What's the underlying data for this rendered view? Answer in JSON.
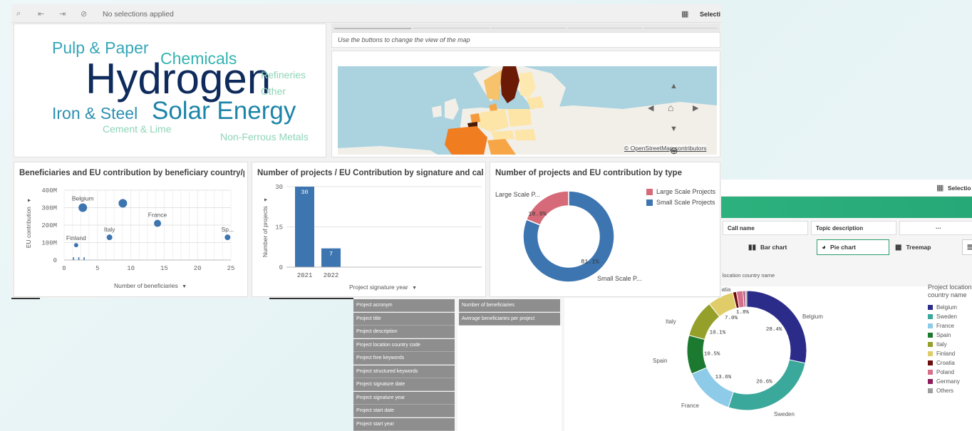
{
  "toolbar": {
    "no_selections": "No selections applied",
    "selections_label": "Selecti",
    "selections_label_back": "Selectio"
  },
  "word_cloud": {
    "words": [
      {
        "text": "Pulp & Paper",
        "color": "#37a6b8"
      },
      {
        "text": "Chemicals",
        "color": "#33b3b0"
      },
      {
        "text": "Hydrogen",
        "color": "#0e2b5c"
      },
      {
        "text": "Refineries",
        "color": "#8ed5b8"
      },
      {
        "text": "Other",
        "color": "#8ed5b8"
      },
      {
        "text": "Iron & Steel",
        "color": "#2d8fb0"
      },
      {
        "text": "Solar Energy",
        "color": "#1d85a8"
      },
      {
        "text": "Cement & Lime",
        "color": "#8ed5b8"
      },
      {
        "text": "Non-Ferrous Metals",
        "color": "#8ed5b8"
      }
    ]
  },
  "map": {
    "hint": "Use the buttons to change the view of the map",
    "attribution": "© OpenStreetMap contributors"
  },
  "charts": [
    {
      "title": "Beneficiaries and EU contribution by beneficiary country/pr...",
      "chart_data": {
        "type": "scatter",
        "xlabel": "Number of beneficiaries",
        "ylabel": "EU contribution",
        "x_ticks": [
          "0",
          "5",
          "10",
          "15",
          "20",
          "25"
        ],
        "y_ticks": [
          "0",
          "100M",
          "200M",
          "300M",
          "400M"
        ],
        "xlim": [
          0,
          25
        ],
        "ylim": [
          0,
          400
        ],
        "points": [
          {
            "label": "Belgium",
            "x": 2.8,
            "y": 300,
            "r": 6
          },
          {
            "label": "",
            "x": 8.8,
            "y": 325,
            "r": 6
          },
          {
            "label": "France",
            "x": 14,
            "y": 210,
            "r": 5
          },
          {
            "label": "Italy",
            "x": 6.8,
            "y": 130,
            "r": 4
          },
          {
            "label": "Finland",
            "x": 1.8,
            "y": 85,
            "r": 3
          },
          {
            "label": "Sp...",
            "x": 24.5,
            "y": 130,
            "r": 4
          },
          {
            "label": "",
            "x": 1.4,
            "y": 8,
            "r": 1
          },
          {
            "label": "",
            "x": 2.2,
            "y": 8,
            "r": 1
          },
          {
            "label": "",
            "x": 3.0,
            "y": 8,
            "r": 1
          }
        ]
      }
    },
    {
      "title": "Number of projects / EU Contribution by signature and call ...",
      "chart_data": {
        "type": "bar",
        "categories": [
          "2021",
          "2022"
        ],
        "values": [
          30,
          7
        ],
        "xlabel": "Project signature year",
        "ylabel": "Number of projects",
        "y_ticks": [
          "0",
          "15",
          "30"
        ],
        "ylim": [
          0,
          30
        ]
      }
    },
    {
      "title": "Number of projects and EU contribution by type",
      "chart_data": {
        "type": "pie",
        "slices": [
          {
            "label": "Large Scale P...",
            "value": 18.9,
            "text": "18.9%",
            "color": "#d66a78"
          },
          {
            "label": "Small Scale P...",
            "value": 81.1,
            "text": "81.1%",
            "color": "#3d75b0"
          }
        ],
        "legend": [
          "Large Scale Projects",
          "Small Scale Projects"
        ]
      }
    }
  ],
  "back": {
    "filters": [
      "Call name",
      "Topic description",
      "···"
    ],
    "views": [
      "Bar chart",
      "Pie chart",
      "Treemap"
    ],
    "dimension_list": [
      "Project acronym",
      "Project title",
      "Project description",
      "Project location country code",
      "Project free keywords",
      "Project structured keywords",
      "Project signature date",
      "Project signature year",
      "Project start date",
      "Project start year"
    ],
    "measure_list": [
      "Number of beneficiaries",
      "Average beneficiaries per project"
    ],
    "pie_title": "ject location country name",
    "legend_title_1": "Project location",
    "legend_title_2": "country name",
    "chart_data": {
      "type": "pie",
      "slices": [
        {
          "label": "Belgium",
          "value": 28.4,
          "text": "28.4%",
          "color": "#2b2b8a"
        },
        {
          "label": "Sweden",
          "value": 26.6,
          "text": "26.6%",
          "color": "#3aa89a"
        },
        {
          "label": "France",
          "value": 13.6,
          "text": "13.6%",
          "color": "#8dcbe8"
        },
        {
          "label": "Spain",
          "value": 10.5,
          "text": "10.5%",
          "color": "#1c7a30"
        },
        {
          "label": "Italy",
          "value": 10.1,
          "text": "10.1%",
          "color": "#94a02a"
        },
        {
          "label": "Finland",
          "value": 7.0,
          "text": "7.0%",
          "color": "#e0cd6a"
        },
        {
          "label": "Croatia",
          "value": 1.0,
          "text": "",
          "color": "#6e0d0d"
        },
        {
          "label": "Poland",
          "value": 1.8,
          "text": "1.8%",
          "color": "#d6708a"
        },
        {
          "label": "Germany",
          "value": 0.5,
          "text": "",
          "color": "#8c1c5a"
        },
        {
          "label": "Others",
          "value": 0.5,
          "text": "",
          "color": "#9e9e9e"
        }
      ],
      "outer_labels": [
        "Belgium",
        "Sweden",
        "France",
        "Spain",
        "Italy",
        "oatia"
      ]
    }
  }
}
